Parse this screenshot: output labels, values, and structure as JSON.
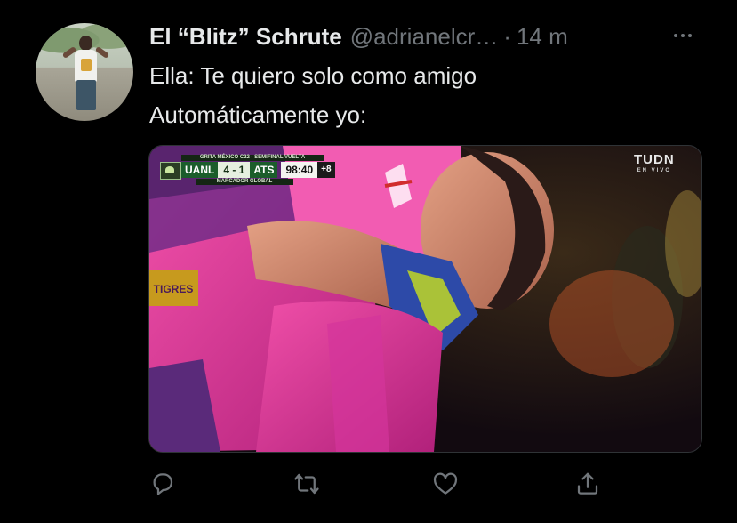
{
  "tweet": {
    "author": {
      "display_name": "El “Blitz” Schrute",
      "handle": "@adrianelcr…",
      "separator": "·",
      "time": "14 m"
    },
    "text_lines": [
      "Ella: Te quiero solo como amigo",
      "Automáticamente yo:"
    ],
    "media": {
      "scorebug": {
        "competition": "GRITA MÉXICO C22 · SEMIFINAL VUELTA",
        "home_team": "UANL",
        "score": "4 - 1",
        "away_team": "ATS",
        "clock": "98:40",
        "added_time": "+8",
        "footer": "MARCADOR GLOBAL"
      },
      "broadcaster": {
        "logo": "TUDN",
        "tagline": "EN VIVO"
      }
    },
    "actions": [
      {
        "name": "reply",
        "icon": "reply-icon"
      },
      {
        "name": "retweet",
        "icon": "retweet-icon"
      },
      {
        "name": "like",
        "icon": "heart-icon"
      },
      {
        "name": "share",
        "icon": "share-icon"
      }
    ]
  },
  "colors": {
    "background": "#000000",
    "primary_text": "#e7e9ea",
    "secondary_text": "#71767b",
    "border": "#2f3336"
  }
}
